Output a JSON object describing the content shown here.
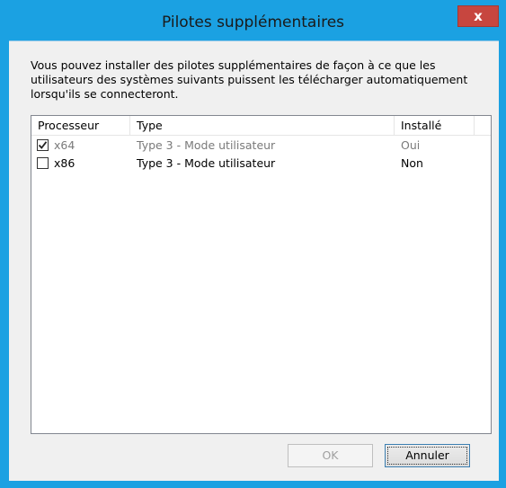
{
  "window": {
    "title": "Pilotes supplémentaires",
    "close_label": "x"
  },
  "description": "Vous pouvez installer des pilotes supplémentaires de façon à ce que les utilisateurs des systèmes suivants puissent les télécharger automatiquement lorsqu'ils se connecteront.",
  "list": {
    "columns": [
      "Processeur",
      "Type",
      "Installé"
    ],
    "rows": [
      {
        "processor": "x64",
        "type": "Type 3 - Mode utilisateur",
        "installed": "Oui",
        "checked": true,
        "disabled": true
      },
      {
        "processor": "x86",
        "type": "Type 3 - Mode utilisateur",
        "installed": "Non",
        "checked": false,
        "disabled": false
      }
    ]
  },
  "buttons": {
    "ok_label": "OK",
    "cancel_label": "Annuler"
  },
  "colors": {
    "accent": "#1ba1e2",
    "close": "#c7463f"
  },
  "icons": {
    "close": "close-icon",
    "checkmark": "checkmark-icon"
  }
}
